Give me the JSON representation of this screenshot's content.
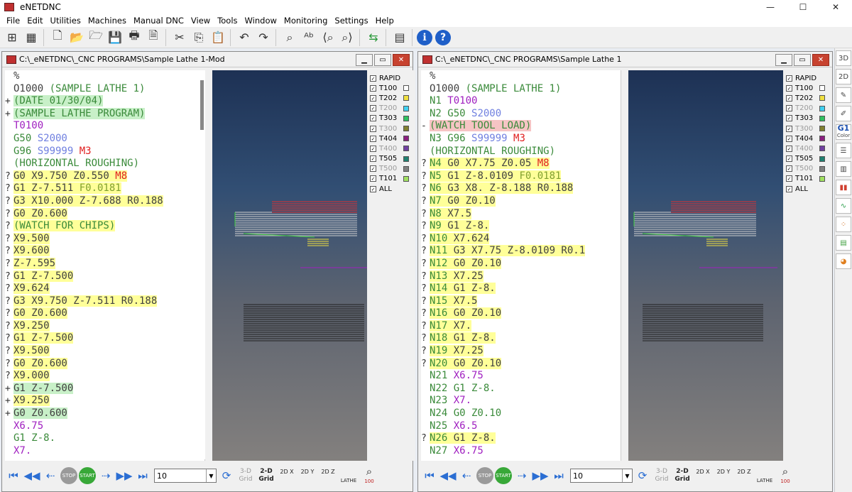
{
  "app": {
    "title": "eNETDNC",
    "window_controls": [
      "—",
      "☐",
      "✕"
    ]
  },
  "menu": [
    "File",
    "Edit",
    "Utilities",
    "Machines",
    "Manual DNC",
    "View",
    "Tools",
    "Window",
    "Monitoring",
    "Settings",
    "Help"
  ],
  "toolbar": {
    "icons": [
      "tree-icon",
      "grid-icon",
      "new-file-icon",
      "open-folder-icon",
      "folder-icon",
      "save-icon",
      "print-icon",
      "preview-icon",
      "cut-icon",
      "copy-icon",
      "paste-icon",
      "undo-icon",
      "redo-icon",
      "find-icon",
      "replace-icon",
      "find-prev-icon",
      "find-next-icon",
      "compare-icon",
      "calculator-icon",
      "info-icon",
      "help-icon"
    ]
  },
  "left": {
    "title": "C:\\_eNETDNC\\_CNC PROGRAMS\\Sample Lathe 1-Mod",
    "lines": [
      {
        "m": "",
        "h": "",
        "s": [
          {
            "t": "%",
            "c": "blk"
          }
        ]
      },
      {
        "m": "",
        "h": "",
        "s": [
          {
            "t": "O1000 ",
            "c": "blk"
          },
          {
            "t": "(SAMPLE LATHE 1)",
            "c": "grn"
          }
        ]
      },
      {
        "m": "+",
        "h": "g",
        "s": [
          {
            "t": "(DATE 01/30/04)",
            "c": "grn"
          }
        ]
      },
      {
        "m": "+",
        "h": "g",
        "s": [
          {
            "t": "(SAMPLE LATHE PROGRAM)",
            "c": "grn"
          }
        ]
      },
      {
        "m": "",
        "h": "",
        "s": [
          {
            "t": "T0100",
            "c": "mag"
          }
        ]
      },
      {
        "m": "",
        "h": "",
        "s": [
          {
            "t": "G50 ",
            "c": "grn"
          },
          {
            "t": "S2000",
            "c": "lbl"
          }
        ]
      },
      {
        "m": "",
        "h": "",
        "s": [
          {
            "t": "G96 ",
            "c": "grn"
          },
          {
            "t": "S99999 ",
            "c": "lbl"
          },
          {
            "t": "M3",
            "c": "red"
          }
        ]
      },
      {
        "m": "",
        "h": "",
        "s": [
          {
            "t": "(HORIZONTAL ROUGHING)",
            "c": "grn"
          }
        ]
      },
      {
        "m": "?",
        "h": "y",
        "s": [
          {
            "t": "G0 X9.750 Z0.550 ",
            "c": "blk"
          },
          {
            "t": "M8",
            "c": "red"
          }
        ]
      },
      {
        "m": "?",
        "h": "y",
        "s": [
          {
            "t": "G1 Z-7.511 ",
            "c": "blk"
          },
          {
            "t": "F0.0181",
            "c": "olv"
          }
        ]
      },
      {
        "m": "?",
        "h": "y",
        "s": [
          {
            "t": "G3 X10.000 Z-7.688 R0.188",
            "c": "blk"
          }
        ]
      },
      {
        "m": "?",
        "h": "y",
        "s": [
          {
            "t": "G0 Z0.600",
            "c": "blk"
          }
        ]
      },
      {
        "m": "?",
        "h": "y",
        "s": [
          {
            "t": "(WATCH FOR CHIPS)",
            "c": "grn"
          }
        ]
      },
      {
        "m": "?",
        "h": "y",
        "s": [
          {
            "t": "X9.500",
            "c": "blk"
          }
        ]
      },
      {
        "m": "?",
        "h": "y",
        "s": [
          {
            "t": "X9.600",
            "c": "blk"
          }
        ]
      },
      {
        "m": "?",
        "h": "y",
        "s": [
          {
            "t": "Z-7.595",
            "c": "blk"
          }
        ]
      },
      {
        "m": "?",
        "h": "y",
        "s": [
          {
            "t": "G1 Z-7.500",
            "c": "blk"
          }
        ]
      },
      {
        "m": "?",
        "h": "y",
        "s": [
          {
            "t": "X9.624",
            "c": "blk"
          }
        ]
      },
      {
        "m": "?",
        "h": "y",
        "s": [
          {
            "t": "G3 X9.750 Z-7.511 R0.188",
            "c": "blk"
          }
        ]
      },
      {
        "m": "?",
        "h": "y",
        "s": [
          {
            "t": "G0 Z0.600",
            "c": "blk"
          }
        ]
      },
      {
        "m": "?",
        "h": "y",
        "s": [
          {
            "t": "X9.250",
            "c": "blk"
          }
        ]
      },
      {
        "m": "?",
        "h": "y",
        "s": [
          {
            "t": "G1 Z-7.500",
            "c": "blk"
          }
        ]
      },
      {
        "m": "?",
        "h": "y",
        "s": [
          {
            "t": "X9.500",
            "c": "blk"
          }
        ]
      },
      {
        "m": "?",
        "h": "y",
        "s": [
          {
            "t": "G0 Z0.600",
            "c": "blk"
          }
        ]
      },
      {
        "m": "?",
        "h": "y",
        "s": [
          {
            "t": "X9.000",
            "c": "blk"
          }
        ]
      },
      {
        "m": "+",
        "h": "g",
        "s": [
          {
            "t": "G1 Z-7.500",
            "c": "blk"
          }
        ]
      },
      {
        "m": "+",
        "h": "y",
        "s": [
          {
            "t": "X9.250",
            "c": "blk"
          }
        ]
      },
      {
        "m": "+",
        "h": "g",
        "s": [
          {
            "t": "G0 Z0.600",
            "c": "blk"
          }
        ]
      },
      {
        "m": "",
        "h": "",
        "s": [
          {
            "t": "X6.75",
            "c": "mag"
          }
        ]
      },
      {
        "m": "",
        "h": "",
        "s": [
          {
            "t": "G1 Z-8.",
            "c": "grn"
          }
        ]
      },
      {
        "m": "",
        "h": "",
        "s": [
          {
            "t": "X7.",
            "c": "mag"
          }
        ]
      }
    ]
  },
  "right": {
    "title": "C:\\_eNETDNC\\_CNC PROGRAMS\\Sample Lathe 1",
    "lines": [
      {
        "m": "",
        "h": "",
        "s": [
          {
            "t": "%",
            "c": "blk"
          }
        ]
      },
      {
        "m": "",
        "h": "",
        "s": [
          {
            "t": "O1000 ",
            "c": "blk"
          },
          {
            "t": "(SAMPLE LATHE 1)",
            "c": "grn"
          }
        ]
      },
      {
        "m": "",
        "h": "",
        "s": [
          {
            "t": "N1 ",
            "c": "grn"
          },
          {
            "t": "T0100",
            "c": "mag"
          }
        ]
      },
      {
        "m": "",
        "h": "",
        "s": [
          {
            "t": "N2 ",
            "c": "grn"
          },
          {
            "t": "G50 ",
            "c": "grn"
          },
          {
            "t": "S2000",
            "c": "lbl"
          }
        ]
      },
      {
        "m": "-",
        "h": "r",
        "s": [
          {
            "t": "(WATCH TOOL LOAD)",
            "c": "grn"
          }
        ]
      },
      {
        "m": "",
        "h": "",
        "s": [
          {
            "t": "N3 ",
            "c": "grn"
          },
          {
            "t": "G96 ",
            "c": "grn"
          },
          {
            "t": "S99999 ",
            "c": "lbl"
          },
          {
            "t": "M3",
            "c": "red"
          }
        ]
      },
      {
        "m": "",
        "h": "",
        "s": [
          {
            "t": "(HORIZONTAL ROUGHING)",
            "c": "grn"
          }
        ]
      },
      {
        "m": "?",
        "h": "y",
        "s": [
          {
            "t": "N4 ",
            "c": "grn"
          },
          {
            "t": "G0 X7.75 Z0.05 ",
            "c": "blk"
          },
          {
            "t": "M8",
            "c": "red"
          }
        ]
      },
      {
        "m": "?",
        "h": "y",
        "s": [
          {
            "t": "N5 ",
            "c": "grn"
          },
          {
            "t": "G1 Z-8.0109 ",
            "c": "blk"
          },
          {
            "t": "F0.0181",
            "c": "olv"
          }
        ]
      },
      {
        "m": "?",
        "h": "y",
        "s": [
          {
            "t": "N6 ",
            "c": "grn"
          },
          {
            "t": "G3 X8. Z-8.188 R0.188",
            "c": "blk"
          }
        ]
      },
      {
        "m": "?",
        "h": "y",
        "s": [
          {
            "t": "N7 ",
            "c": "grn"
          },
          {
            "t": "G0 Z0.10",
            "c": "blk"
          }
        ]
      },
      {
        "m": "?",
        "h": "y",
        "s": [
          {
            "t": "N8 ",
            "c": "grn"
          },
          {
            "t": "X7.5",
            "c": "blk"
          }
        ]
      },
      {
        "m": "?",
        "h": "y",
        "s": [
          {
            "t": "N9 ",
            "c": "grn"
          },
          {
            "t": "G1 Z-8.",
            "c": "blk"
          }
        ]
      },
      {
        "m": "?",
        "h": "y",
        "s": [
          {
            "t": "N10 ",
            "c": "grn"
          },
          {
            "t": "X7.624",
            "c": "blk"
          }
        ]
      },
      {
        "m": "?",
        "h": "y",
        "s": [
          {
            "t": "N11 ",
            "c": "grn"
          },
          {
            "t": "G3 X7.75 Z-8.0109 R0.1",
            "c": "blk"
          }
        ]
      },
      {
        "m": "?",
        "h": "y",
        "s": [
          {
            "t": "N12 ",
            "c": "grn"
          },
          {
            "t": "G0 Z0.10",
            "c": "blk"
          }
        ]
      },
      {
        "m": "?",
        "h": "y",
        "s": [
          {
            "t": "N13 ",
            "c": "grn"
          },
          {
            "t": "X7.25",
            "c": "blk"
          }
        ]
      },
      {
        "m": "?",
        "h": "y",
        "s": [
          {
            "t": "N14 ",
            "c": "grn"
          },
          {
            "t": "G1 Z-8.",
            "c": "blk"
          }
        ]
      },
      {
        "m": "?",
        "h": "y",
        "s": [
          {
            "t": "N15 ",
            "c": "grn"
          },
          {
            "t": "X7.5",
            "c": "blk"
          }
        ]
      },
      {
        "m": "?",
        "h": "y",
        "s": [
          {
            "t": "N16 ",
            "c": "grn"
          },
          {
            "t": "G0 Z0.10",
            "c": "blk"
          }
        ]
      },
      {
        "m": "?",
        "h": "y",
        "s": [
          {
            "t": "N17 ",
            "c": "grn"
          },
          {
            "t": "X7.",
            "c": "blk"
          }
        ]
      },
      {
        "m": "?",
        "h": "y",
        "s": [
          {
            "t": "N18 ",
            "c": "grn"
          },
          {
            "t": "G1 Z-8.",
            "c": "blk"
          }
        ]
      },
      {
        "m": "?",
        "h": "y",
        "s": [
          {
            "t": "N19 ",
            "c": "grn"
          },
          {
            "t": "X7.25",
            "c": "blk"
          }
        ]
      },
      {
        "m": "?",
        "h": "y",
        "s": [
          {
            "t": "N20 ",
            "c": "grn"
          },
          {
            "t": "G0 Z0.10",
            "c": "blk"
          }
        ]
      },
      {
        "m": "",
        "h": "",
        "s": [
          {
            "t": "N21 ",
            "c": "grn"
          },
          {
            "t": "X6.75",
            "c": "mag"
          }
        ]
      },
      {
        "m": "",
        "h": "",
        "s": [
          {
            "t": "N22 ",
            "c": "grn"
          },
          {
            "t": "G1 Z-8.",
            "c": "grn"
          }
        ]
      },
      {
        "m": "",
        "h": "",
        "s": [
          {
            "t": "N23 ",
            "c": "grn"
          },
          {
            "t": "X7.",
            "c": "mag"
          }
        ]
      },
      {
        "m": "",
        "h": "",
        "s": [
          {
            "t": "N24 ",
            "c": "grn"
          },
          {
            "t": "G0 Z0.10",
            "c": "grn"
          }
        ]
      },
      {
        "m": "",
        "h": "",
        "s": [
          {
            "t": "N25 ",
            "c": "grn"
          },
          {
            "t": "X6.5",
            "c": "mag"
          }
        ]
      },
      {
        "m": "?",
        "h": "y",
        "s": [
          {
            "t": "N26 ",
            "c": "grn"
          },
          {
            "t": "G1 Z-8.",
            "c": "blk"
          }
        ]
      },
      {
        "m": "",
        "h": "",
        "s": [
          {
            "t": "N27 ",
            "c": "grn"
          },
          {
            "t": "X6.75",
            "c": "mag"
          }
        ]
      }
    ]
  },
  "legend": [
    {
      "label": "RAPID",
      "checked": true,
      "dim": false,
      "color": ""
    },
    {
      "label": "T100",
      "checked": true,
      "dim": false,
      "color": "#ffffff"
    },
    {
      "label": "T202",
      "checked": true,
      "dim": false,
      "color": "#f0e040"
    },
    {
      "label": "T200",
      "checked": true,
      "dim": true,
      "color": "#40d0f0"
    },
    {
      "label": "T303",
      "checked": true,
      "dim": false,
      "color": "#30c060"
    },
    {
      "label": "T300",
      "checked": true,
      "dim": true,
      "color": "#808030"
    },
    {
      "label": "T404",
      "checked": true,
      "dim": false,
      "color": "#8a2080"
    },
    {
      "label": "T400",
      "checked": true,
      "dim": true,
      "color": "#7040a0"
    },
    {
      "label": "T505",
      "checked": true,
      "dim": false,
      "color": "#208070"
    },
    {
      "label": "T500",
      "checked": true,
      "dim": true,
      "color": "#808080"
    },
    {
      "label": "T101",
      "checked": true,
      "dim": false,
      "color": "#a0e060"
    },
    {
      "label": "ALL",
      "checked": true,
      "dim": false,
      "color": ""
    }
  ],
  "nav": {
    "speed": "10",
    "stop_label": "STOP",
    "start_label": "START",
    "grid3d": [
      "3-D",
      "Grid"
    ],
    "grid2d": [
      "2-D",
      "Grid"
    ],
    "views": [
      "2D X",
      "2D Y",
      "2D Z"
    ],
    "lathe_label": "LATHE",
    "zoom_label": "100"
  },
  "sidebar": [
    "3D",
    "2D",
    "G1",
    "Color"
  ]
}
